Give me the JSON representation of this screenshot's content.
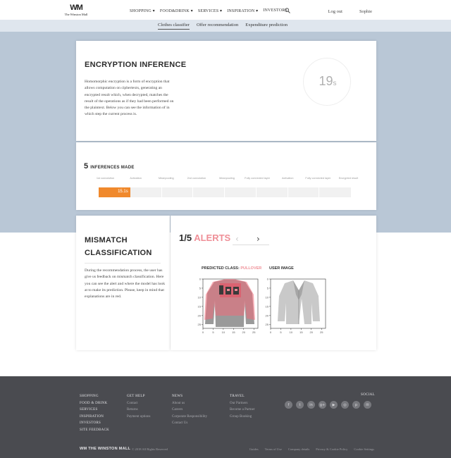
{
  "header": {
    "logo_mark": "WM",
    "logo_text": "The Winston Mall",
    "nav": [
      "SHOPPING",
      "FOOD&DRINK",
      "SERVICES",
      "INSPIRATION",
      "INVESTORS"
    ],
    "logout": "Log out",
    "user": "Sophie"
  },
  "subnav": {
    "items": [
      "Clothes classifier",
      "Offer recommendation",
      "Expenditure prediction"
    ],
    "active": "Clothes classifier"
  },
  "encryption": {
    "title": "ENCRYPTION INFERENCE",
    "text": "Homomorphic encryption is a form of encryption that allows computation on ciphertexts, generating an encrypted result which, when decrypted, matches the result of the operations as if they had been performed on the plaintext. Below you can see the information of in which step the current process is.",
    "timer_value": "19",
    "timer_unit": "s"
  },
  "inferences": {
    "count": "5",
    "label": "INFERENCES MADE",
    "stages": [
      "1st convolution",
      "Activation",
      "Meanpooling",
      "2nd convolution",
      "Meanpooling",
      "Fully connected layer",
      "Activation",
      "Fully connected layer",
      "Encrypted result"
    ],
    "progress_label": "15.1s",
    "progress_fraction": 0.125
  },
  "mismatch": {
    "title_line1": "MISMATCH",
    "title_line2": "CLASSIFICATION",
    "text": "During the recommendation process, the user has give us feedback on mismatch classification. Here you can see the alert and where the model has look at to make its prediction. Please, keep in mind that explanations are in red."
  },
  "alerts": {
    "counter": "1/5",
    "word": "ALERTS",
    "prev_icon": "chevron-left-icon",
    "next_icon": "chevron-right-icon",
    "predicted_prefix": "PREDICTED CLASS:",
    "predicted_class": "PULLOVER",
    "user_image_label": "USER IMAGE",
    "y_ticks": [
      "0",
      "5",
      "10",
      "15",
      "20",
      "25"
    ],
    "x_ticks": [
      "0",
      "5",
      "10",
      "15",
      "20",
      "25"
    ]
  },
  "footer": {
    "col1": [
      "SHOPPING",
      "FOOD & DRINK",
      "SERVICES",
      "INSPIRATION",
      "INVESTORS",
      "SITE FEEDBACK"
    ],
    "col2_head": "GET HELP",
    "col2": [
      "Contact",
      "Returns",
      "Payment options"
    ],
    "col3_head": "NEWS",
    "col3": [
      "About us",
      "Careers",
      "Corporate Responsibility",
      "Contact Us"
    ],
    "col4_head": "TRAVEL",
    "col4": [
      "Our Partners",
      "Become a Partner",
      "Group Booking"
    ],
    "social_title": "SOCIAL",
    "social_icons": [
      "facebook-icon",
      "twitter-icon",
      "linkedin-icon",
      "googleplus-icon",
      "youtube-icon",
      "instagram-icon",
      "pinterest-icon",
      "email-icon"
    ],
    "logo_text": "THE WINSTON MALL",
    "copyright": "© 2018 All Rights Reserved",
    "legal": [
      "Guides",
      "Terms of Use",
      "Company details",
      "Privacy & Cookie Policy",
      "Cookie Settings"
    ]
  },
  "colors": {
    "accent_orange": "#f0892c",
    "accent_pink": "#ef8f97",
    "band_blue": "#b9c7d6",
    "footer_bg": "#4a4b50"
  }
}
